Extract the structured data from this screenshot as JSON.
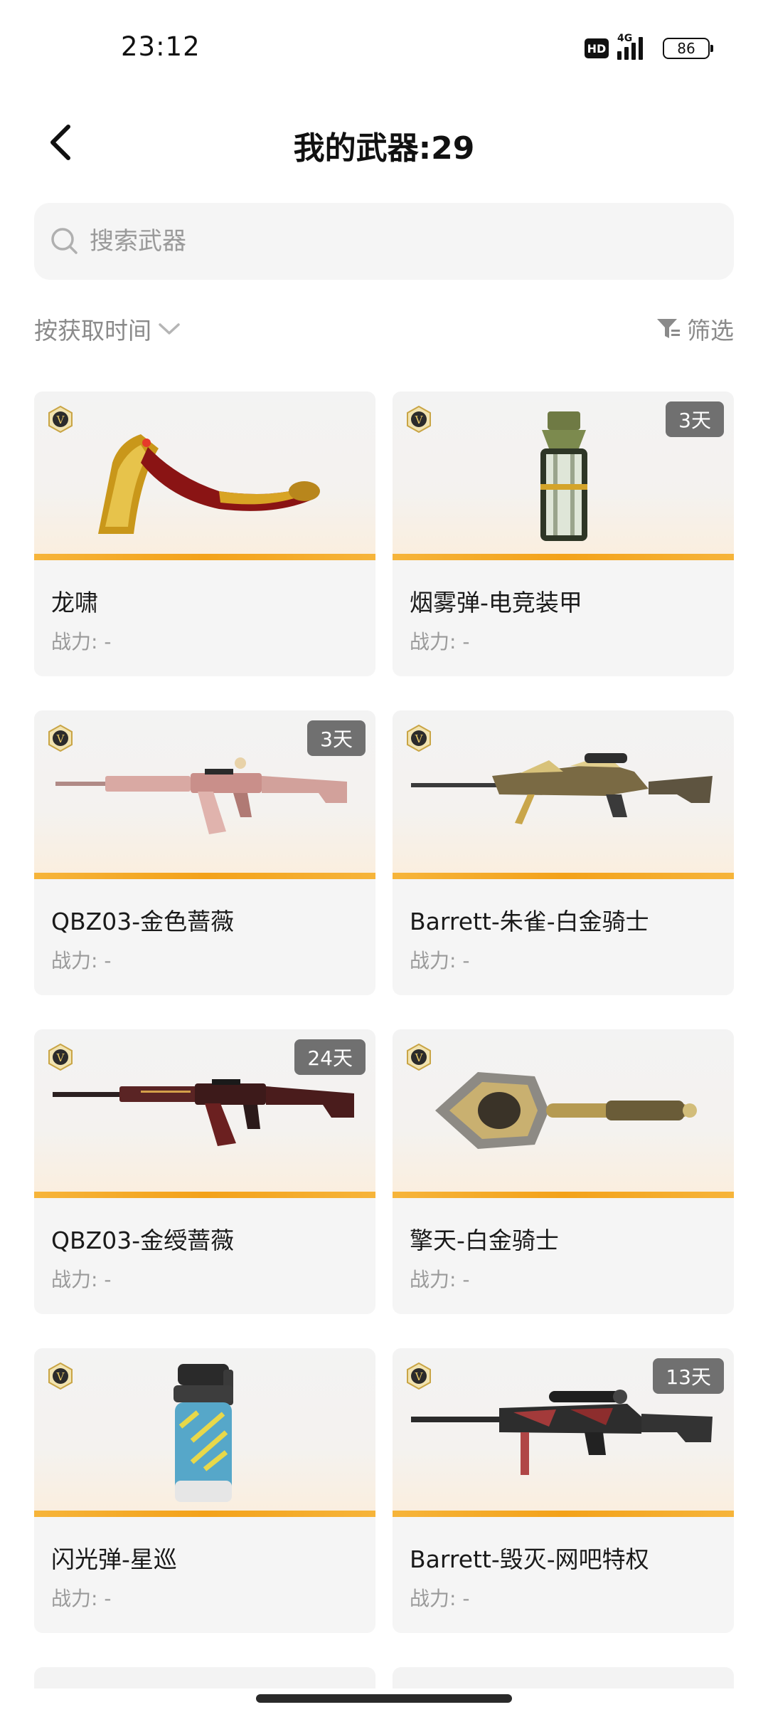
{
  "status_bar": {
    "time": "23:12",
    "hd": "HD",
    "network": "4G",
    "battery": "86"
  },
  "header": {
    "title": "我的武器:29"
  },
  "search": {
    "placeholder": "搜索武器"
  },
  "toolbar": {
    "sort_label": "按获取时间",
    "filter_label": "筛选"
  },
  "weapons": [
    {
      "name": "龙啸",
      "power": "战力: -",
      "days": "",
      "icon": "golden-dragon-axe"
    },
    {
      "name": "烟雾弹-电竞装甲",
      "power": "战力: -",
      "days": "3天",
      "icon": "smoke-grenade"
    },
    {
      "name": "QBZ03-金色蔷薇",
      "power": "战力: -",
      "days": "3天",
      "icon": "rose-gold-rifle"
    },
    {
      "name": "Barrett-朱雀-白金骑士",
      "power": "战力: -",
      "days": "",
      "icon": "platinum-sniper-rifle"
    },
    {
      "name": "QBZ03-金绶蔷薇",
      "power": "战力: -",
      "days": "24天",
      "icon": "dark-red-rifle"
    },
    {
      "name": "擎天-白金骑士",
      "power": "战力: -",
      "days": "",
      "icon": "platinum-shovel"
    },
    {
      "name": "闪光弹-星巡",
      "power": "战力: -",
      "days": "",
      "icon": "flash-grenade"
    },
    {
      "name": "Barrett-毁灭-网吧特权",
      "power": "战力: -",
      "days": "13天",
      "icon": "black-sniper-rifle"
    }
  ],
  "colors": {
    "accent_line": "#f3a21a",
    "tag_bg": "#707070",
    "card_bg": "#f5f5f5"
  }
}
